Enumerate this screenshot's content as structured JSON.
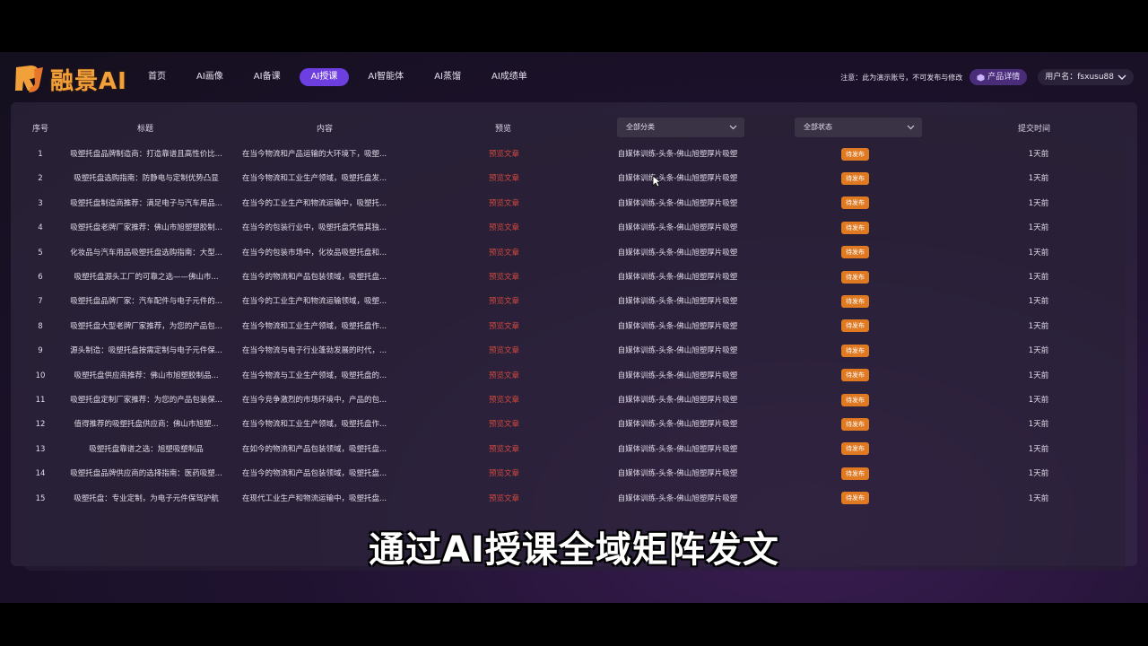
{
  "app": {
    "logo_text": "融景AI"
  },
  "nav": {
    "items": [
      {
        "label": "首页",
        "active": false
      },
      {
        "label": "AI画像",
        "active": false
      },
      {
        "label": "AI备课",
        "active": false
      },
      {
        "label": "AI授课",
        "active": true
      },
      {
        "label": "AI智能体",
        "active": false
      },
      {
        "label": "AI蒸馏",
        "active": false
      },
      {
        "label": "AI成绩单",
        "active": false
      }
    ],
    "notice": "注意：此为演示账号，不可发布与修改",
    "product_btn": "产品详情",
    "user": "用户名：fsxusu88"
  },
  "table": {
    "headers": {
      "index": "序号",
      "title": "标题",
      "content": "内容",
      "preview": "预览",
      "time": "提交时间"
    },
    "category_filter": "全部分类",
    "status_filter": "全部状态",
    "rows": [
      {
        "index": "1",
        "title": "吸塑托盘品牌制造商：打造靠谱且高性价比...",
        "content": "在当今物流和产品运输的大环境下，吸塑...",
        "preview": "预览文章",
        "category": "自媒体训练-头条-佛山旭塑厚片吸塑",
        "status": "待发布",
        "time": "1天前"
      },
      {
        "index": "2",
        "title": "吸塑托盘选购指南：防静电与定制优势凸显",
        "content": "在当今物流和工业生产领域，吸塑托盘发...",
        "preview": "预览文章",
        "category": "自媒体训练-头条-佛山旭塑厚片吸塑",
        "status": "待发布",
        "time": "1天前"
      },
      {
        "index": "3",
        "title": "吸塑托盘制造商推荐：满足电子与汽车用品...",
        "content": "在当今的工业生产和物流运输中，吸塑托...",
        "preview": "预览文章",
        "category": "自媒体训练-头条-佛山旭塑厚片吸塑",
        "status": "待发布",
        "time": "1天前"
      },
      {
        "index": "4",
        "title": "吸塑托盘老牌厂家推荐：佛山市旭塑塑胶制...",
        "content": "在当今的包装行业中，吸塑托盘凭借其独...",
        "preview": "预览文章",
        "category": "自媒体训练-头条-佛山旭塑厚片吸塑",
        "status": "待发布",
        "time": "1天前"
      },
      {
        "index": "5",
        "title": "化妆品与汽车用品吸塑托盘选购指南：大型...",
        "content": "在当今的包装市场中，化妆品吸塑托盘和...",
        "preview": "预览文章",
        "category": "自媒体训练-头条-佛山旭塑厚片吸塑",
        "status": "待发布",
        "time": "1天前"
      },
      {
        "index": "6",
        "title": "吸塑托盘源头工厂的可靠之选——佛山市...",
        "content": "在当今的物流和产品包装领域，吸塑托盘...",
        "preview": "预览文章",
        "category": "自媒体训练-头条-佛山旭塑厚片吸塑",
        "status": "待发布",
        "time": "1天前"
      },
      {
        "index": "7",
        "title": "吸塑托盘品牌厂家：汽车配件与电子元件的...",
        "content": "在当今的工业生产和物流运输领域，吸塑...",
        "preview": "预览文章",
        "category": "自媒体训练-头条-佛山旭塑厚片吸塑",
        "status": "待发布",
        "time": "1天前"
      },
      {
        "index": "8",
        "title": "吸塑托盘大型老牌厂家推荐，为您的产品包...",
        "content": "在当今物流和工业生产领域，吸塑托盘作...",
        "preview": "预览文章",
        "category": "自媒体训练-头条-佛山旭塑厚片吸塑",
        "status": "待发布",
        "time": "1天前"
      },
      {
        "index": "9",
        "title": "源头制造：吸塑托盘按需定制与电子元件保...",
        "content": "在当今物流与电子行业蓬勃发展的时代，...",
        "preview": "预览文章",
        "category": "自媒体训练-头条-佛山旭塑厚片吸塑",
        "status": "待发布",
        "time": "1天前"
      },
      {
        "index": "10",
        "title": "吸塑托盘供应商推荐：佛山市旭塑胶制品...",
        "content": "在当今物流与工业生产领域，吸塑托盘的...",
        "preview": "预览文章",
        "category": "自媒体训练-头条-佛山旭塑厚片吸塑",
        "status": "待发布",
        "time": "1天前"
      },
      {
        "index": "11",
        "title": "吸塑托盘定制厂家推荐：为您的产品包装保...",
        "content": "在当今竞争激烈的市场环境中，产品的包...",
        "preview": "预览文章",
        "category": "自媒体训练-头条-佛山旭塑厚片吸塑",
        "status": "待发布",
        "time": "1天前"
      },
      {
        "index": "12",
        "title": "值得推荐的吸塑托盘供应商：佛山市旭塑...",
        "content": "在当今物流和工业生产领域，吸塑托盘作...",
        "preview": "预览文章",
        "category": "自媒体训练-头条-佛山旭塑厚片吸塑",
        "status": "待发布",
        "time": "1天前"
      },
      {
        "index": "13",
        "title": "吸塑托盘靠谱之选：旭塑吸塑制品",
        "content": "在如今的物流和产品包装领域，吸塑托盘...",
        "preview": "预览文章",
        "category": "自媒体训练-头条-佛山旭塑厚片吸塑",
        "status": "待发布",
        "time": "1天前"
      },
      {
        "index": "14",
        "title": "吸塑托盘品牌供应商的选择指南：医药吸塑...",
        "content": "在当今的物流和产品包装领域，吸塑托盘...",
        "preview": "预览文章",
        "category": "自媒体训练-头条-佛山旭塑厚片吸塑",
        "status": "待发布",
        "time": "1天前"
      },
      {
        "index": "15",
        "title": "吸塑托盘：专业定制，为电子元件保驾护航",
        "content": "在现代工业生产和物流运输中，吸塑托盘...",
        "preview": "预览文章",
        "category": "自媒体训练-头条-佛山旭塑厚片吸塑",
        "status": "待发布",
        "time": "1天前"
      }
    ]
  },
  "subtitle": "通过AI授课全域矩阵发文",
  "colors": {
    "accent": "#6d3ee0",
    "badge": "#e07a22",
    "preview_link": "#d2493e"
  }
}
